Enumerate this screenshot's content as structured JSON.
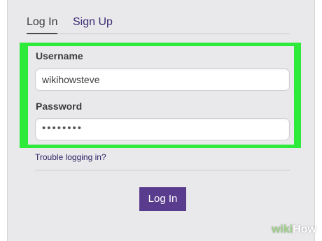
{
  "tabs": {
    "login": "Log In",
    "signup": "Sign Up"
  },
  "form": {
    "username_label": "Username",
    "username_value": "wikihowsteve",
    "password_label": "Password",
    "password_masked": "••••••••"
  },
  "links": {
    "trouble": "Trouble logging in?"
  },
  "buttons": {
    "login": "Log In"
  },
  "watermark": {
    "wiki": "wiki",
    "how": "How"
  },
  "colors": {
    "highlight": "#2eea3a",
    "button": "#5a3c8e",
    "link": "#2c2366",
    "panel_bg": "#e9e8eb"
  }
}
